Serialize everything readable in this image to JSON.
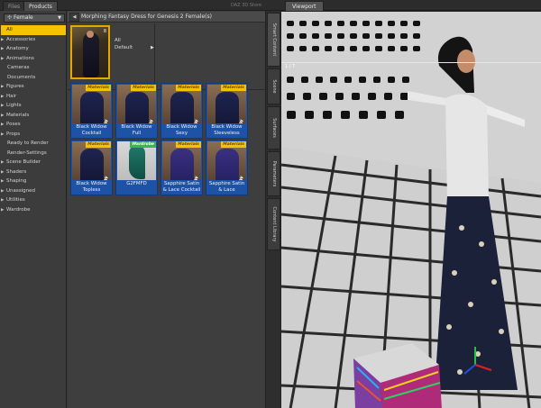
{
  "tabs": [
    "Files",
    "Products"
  ],
  "store_label": "DAZ 3D Store",
  "filter": {
    "selected": "Female",
    "items": [
      {
        "label": "All",
        "selected": true,
        "tri": false,
        "indent": false
      },
      {
        "label": "Accessories",
        "tri": true
      },
      {
        "label": "Anatomy",
        "tri": true
      },
      {
        "label": "Animations",
        "tri": true
      },
      {
        "label": "Cameras",
        "tri": false,
        "indent": true
      },
      {
        "label": "Documents",
        "tri": false,
        "indent": true
      },
      {
        "label": "Figures",
        "tri": true
      },
      {
        "label": "Hair",
        "tri": true
      },
      {
        "label": "Lights",
        "tri": true
      },
      {
        "label": "Materials",
        "tri": true
      },
      {
        "label": "Poses",
        "tri": true
      },
      {
        "label": "Props",
        "tri": true
      },
      {
        "label": "Ready to Render",
        "tri": false,
        "indent": true
      },
      {
        "label": "Render-Settings",
        "tri": false,
        "indent": true
      },
      {
        "label": "Scene Builder",
        "tri": true
      },
      {
        "label": "Shaders",
        "tri": true
      },
      {
        "label": "Shaping",
        "tri": true
      },
      {
        "label": "Unassigned",
        "tri": true
      },
      {
        "label": "Utilities",
        "tri": true
      },
      {
        "label": "Wardrobe",
        "tri": true
      }
    ]
  },
  "breadcrumb": "Morphing Fantasy Dress for Genesis 2 Female(s)",
  "product_options": {
    "all": "All",
    "default": "Default"
  },
  "product_count": "8",
  "grid_items": [
    {
      "label": "Black Widow Cocktail",
      "badge": "Materials",
      "new": true,
      "variant": "dark"
    },
    {
      "label": "Black Widow Full",
      "badge": "Materials",
      "new": true,
      "variant": "dark"
    },
    {
      "label": "Black Widow Sexy",
      "badge": "Materials",
      "new": true,
      "variant": "dark"
    },
    {
      "label": "Black Widow Sleeveless",
      "badge": "Materials",
      "new": true,
      "variant": "dark"
    },
    {
      "label": "Black Widow Topless",
      "badge": "Materials",
      "new": true,
      "variant": "dark"
    },
    {
      "label": "G2FMFD",
      "badge": "Wardrobe",
      "new": false,
      "variant": "green"
    },
    {
      "label": "Sapphire Satin & Lace Cocktail",
      "badge": "Materials",
      "new": true,
      "variant": "violet"
    },
    {
      "label": "Sapphire Satin & Lace",
      "badge": "Materials",
      "new": true,
      "variant": "violet"
    }
  ],
  "new_label": "NEW",
  "dock_tabs": [
    "Smart Content",
    "Scene",
    "Surfaces",
    "Parameters",
    "Content Library"
  ],
  "viewport_tab": "Viewport",
  "viewport_label": "1 / 7",
  "colors": {
    "accent": "#f6c200",
    "item_bg": "#1d52a6",
    "wardrobe_badge": "#37b84a"
  }
}
